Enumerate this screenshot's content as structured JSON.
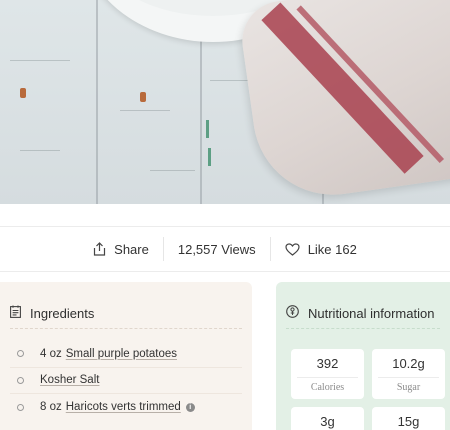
{
  "actions": {
    "share_label": "Share",
    "views_label": "12,557 Views",
    "like_label": "Like 162"
  },
  "ingredients": {
    "title": "Ingredients",
    "items": [
      {
        "amount": "4 oz",
        "name": "Small purple potatoes",
        "info": false
      },
      {
        "amount": "",
        "name": "Kosher Salt",
        "info": false
      },
      {
        "amount": "8 oz",
        "name": "Haricots verts trimmed",
        "info": true
      }
    ]
  },
  "nutrition": {
    "title": "Nutritional information",
    "facts": [
      {
        "value": "392",
        "label": "Calories"
      },
      {
        "value": "10.2g",
        "label": "Sugar"
      },
      {
        "value": "3g",
        "label": ""
      },
      {
        "value": "15g",
        "label": ""
      }
    ]
  },
  "icons": {
    "share": "share-icon",
    "like": "heart-icon",
    "ingredients": "list-icon",
    "nutrition": "nutrition-icon",
    "info": "info-icon"
  }
}
